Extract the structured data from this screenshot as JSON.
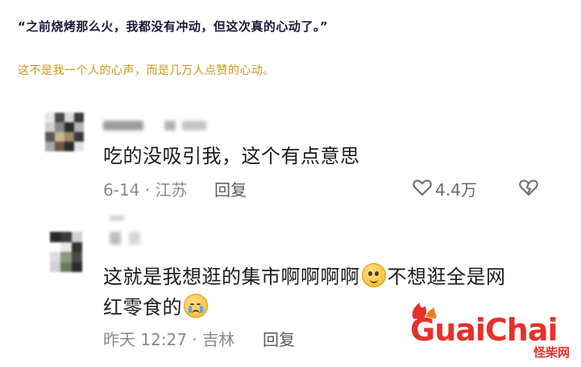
{
  "article": {
    "headline": "“之前烧烤那么火，我都没有冲动，但这次真的心动了。”",
    "subline": "这不是我一个人的心声，而是几万人点赞的心动。"
  },
  "comments": [
    {
      "text": "吃的没吸引我，这个有点意思",
      "date_location": "6-14 · 江苏",
      "reply_label": "回复",
      "like_count": "4.4万"
    },
    {
      "text_part1": "这就是我想逛的集市啊啊啊啊",
      "text_part2": "不想逛全是网",
      "text_line2": "红零食的",
      "date_location": "昨天 12:27 · 吉林",
      "reply_label": "回复"
    }
  ],
  "watermark": {
    "brand": "GuaiChai",
    "brand_cn": "怪柴网"
  },
  "icons": {
    "like": "heart-outline-icon",
    "dislike": "broken-heart-icon",
    "emoji1": "pleading-face-emoji-icon",
    "emoji2": "crying-face-emoji-icon"
  },
  "colors": {
    "headline": "#1a1a3a",
    "subline": "#c79a1c",
    "brand": "#e8302a",
    "meta": "#8a8a8a"
  }
}
